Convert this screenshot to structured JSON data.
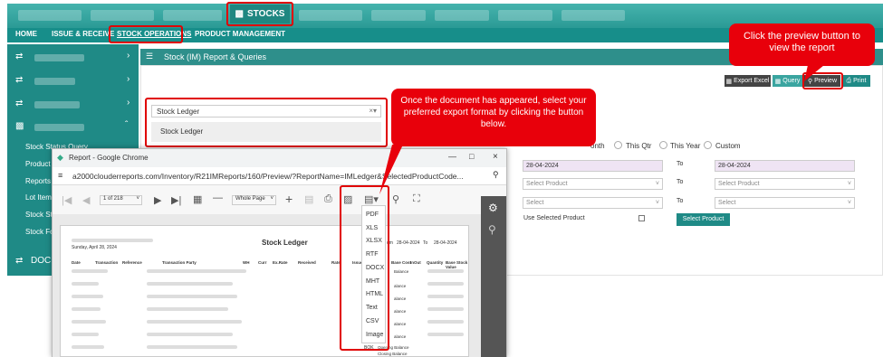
{
  "topnav": {
    "stocks_label": "STOCKS",
    "tabs": [
      "HOME",
      "ISSUE & RECEIVE",
      "STOCK OPERATIONS",
      "PRODUCT MANAGEMENT"
    ]
  },
  "sidebar": {
    "items": [
      "Stock Status Query",
      "Product S",
      "Reports &",
      "Lot Item",
      "Stock Sta",
      "Stock For"
    ],
    "bottom_label": "DOCUM"
  },
  "panel": {
    "title": "Stock (IM) Report & Queries",
    "buttons": {
      "export_excel": "Export Excel",
      "query": "Query",
      "preview": "Preview",
      "print": "Print"
    },
    "report_select_value": "Stock Ledger",
    "report_option": "Stock Ledger",
    "period_options": [
      "onth",
      "This Qtr",
      "This Year",
      "Custom"
    ],
    "date_from": "28-04-2024",
    "to_label": "To",
    "date_to": "28-04-2024",
    "select_product_placeholder": "Select Product",
    "select_placeholder": "Select",
    "use_selected_product_label": "Use Selected Product",
    "select_product_button": "Select Product"
  },
  "chrome_window": {
    "title": "Report - Google Chrome",
    "url": "a2000clouderreports.com/Inventory/R21IMReports/160/Preview/?ReportName=IMLedger&SelectedProductCode...",
    "page_indicator": "1 of 218",
    "page_layout": "Whole Page",
    "export_formats": [
      "PDF",
      "XLS",
      "XLSX",
      "RTF",
      "DOCX",
      "MHT",
      "HTML",
      "Text",
      "CSV",
      "Image"
    ],
    "doc_title": "Stock Ledger",
    "doc_date": "Sunday, April 28, 2024",
    "doc_from_label": "om",
    "doc_from": "28-04-2024",
    "doc_to_label": "To",
    "doc_to": "28-04-2024",
    "columns": [
      "Date",
      "Transaction",
      "Reference",
      "Transaction Party",
      "WH",
      "Curr",
      "Ex.Rate",
      "Received",
      "Rate",
      "Issue"
    ],
    "columns_right": [
      "Base Cost",
      "InOut",
      "Quantity",
      "Base Stock Value"
    ],
    "balance_cells": [
      "Balance",
      "alance",
      "alance",
      "alance",
      "alance",
      "alance"
    ],
    "row_codes": [
      "P",
      "BT",
      "BT",
      "P",
      "PR",
      "BOK"
    ],
    "opening_balance": "Opening Balance",
    "closing_balance": "Closing Balance"
  },
  "callouts": {
    "preview": "Click the preview button to view the report",
    "export": "Once the document has appeared, select your preferred export format by clicking the button below."
  },
  "colors": {
    "teal": "#2a9a95",
    "callout_red": "#e8000b",
    "highlight_red": "#e00000"
  }
}
